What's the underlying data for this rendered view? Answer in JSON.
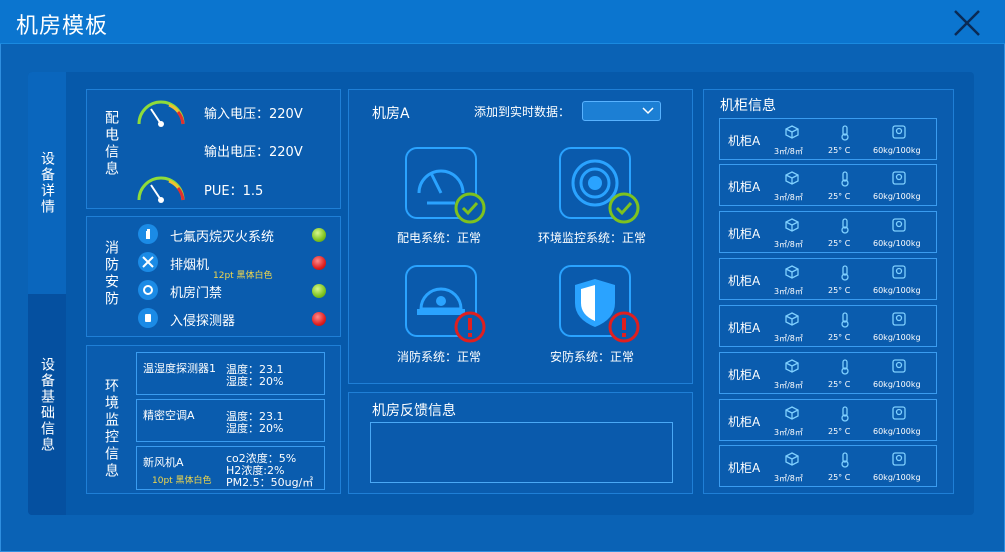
{
  "window": {
    "title": "机房模板"
  },
  "tabs": [
    {
      "label": "设备详情"
    },
    {
      "label": "设备基础信息"
    }
  ],
  "power": {
    "label": "配电信息",
    "input_voltage": "输入电压：220V",
    "output_voltage": "输出电压：220V",
    "pue": "PUE：1.5"
  },
  "fire": {
    "label": "消防安防",
    "items": [
      {
        "label": "七氟丙烷灭火系统",
        "status": "green"
      },
      {
        "label": "排烟机",
        "status": "red"
      },
      {
        "label": "机房门禁",
        "status": "green"
      },
      {
        "label": "入侵探测器",
        "status": "red"
      }
    ],
    "annotation": "12pt 黑体白色"
  },
  "env": {
    "label": "环境监控信息",
    "boxes": [
      {
        "name": "温湿度探测器1",
        "lines": [
          "温度：23.1",
          "湿度：20%"
        ]
      },
      {
        "name": "精密空调A",
        "lines": [
          "温度：23.1",
          "湿度：20%"
        ]
      },
      {
        "name": "新风机A",
        "lines": [
          "co2浓度：5%",
          "H2浓度:2%",
          "PM2.5：50ug/㎥"
        ]
      }
    ],
    "annotation": "10pt 黑体白色"
  },
  "room": {
    "title": "机房A",
    "add_label": "添加到实时数据：",
    "select_value": "",
    "systems": [
      {
        "label": "配电系统：正常",
        "icon": "gauge-icon",
        "status": "ok"
      },
      {
        "label": "环境监控系统：正常",
        "icon": "sensor-icon",
        "status": "ok"
      },
      {
        "label": "消防系统：正常",
        "icon": "helmet-icon",
        "status": "warn"
      },
      {
        "label": "安防系统：正常",
        "icon": "shield-icon",
        "status": "warn"
      }
    ]
  },
  "feedback": {
    "title": "机房反馈信息",
    "value": ""
  },
  "cabinets": {
    "title": "机柜信息",
    "rows": [
      {
        "name": "机柜A",
        "volume": "3㎡/8㎡",
        "temp": "25° C",
        "weight": "60kg/100kg"
      },
      {
        "name": "机柜A",
        "volume": "3㎡/8㎡",
        "temp": "25° C",
        "weight": "60kg/100kg"
      },
      {
        "name": "机柜A",
        "volume": "3㎡/8㎡",
        "temp": "25° C",
        "weight": "60kg/100kg"
      },
      {
        "name": "机柜A",
        "volume": "3㎡/8㎡",
        "temp": "25° C",
        "weight": "60kg/100kg"
      },
      {
        "name": "机柜A",
        "volume": "3㎡/8㎡",
        "temp": "25° C",
        "weight": "60kg/100kg"
      },
      {
        "name": "机柜A",
        "volume": "3㎡/8㎡",
        "temp": "25° C",
        "weight": "60kg/100kg"
      },
      {
        "name": "机柜A",
        "volume": "3㎡/8㎡",
        "temp": "25° C",
        "weight": "60kg/100kg"
      },
      {
        "name": "机柜A",
        "volume": "3㎡/8㎡",
        "temp": "25° C",
        "weight": "60kg/100kg"
      }
    ]
  },
  "colors": {
    "accent": "#2aa3ff",
    "ok": "#7ec21f",
    "alert": "#e01f1f",
    "note": "#f3d84a"
  }
}
